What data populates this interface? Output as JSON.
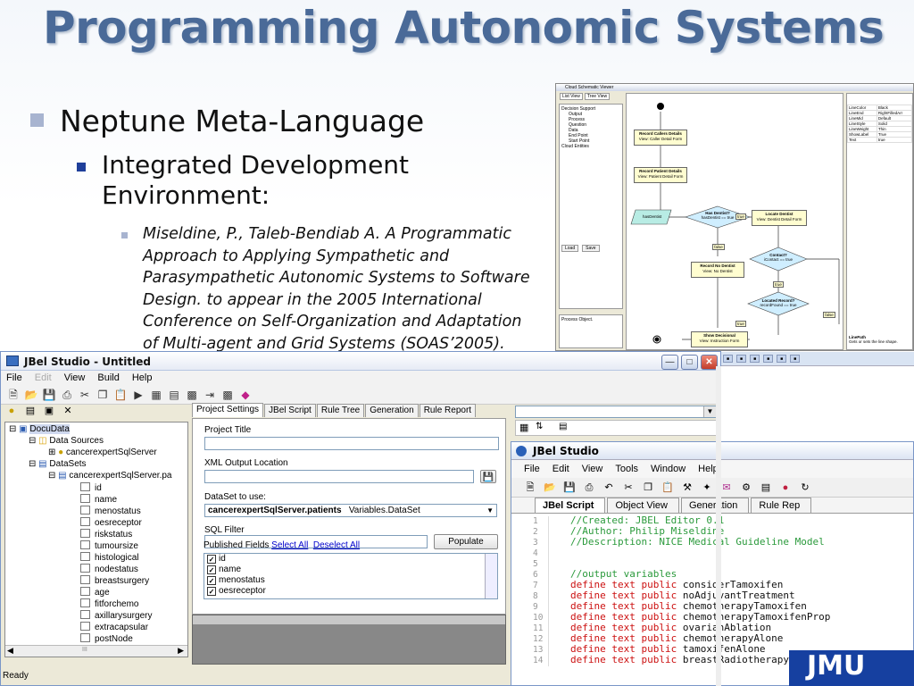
{
  "slide": {
    "title": "Programming Autonomic Systems",
    "bullet1": "Neptune Meta-Language",
    "bullet2": "Integrated Development Environment:",
    "bullet3": "Miseldine, P., Taleb-Bendiab A. A Programmatic Approach to Applying Sympathetic and Parasympathetic Autonomic Systems to Software Design. to appear in the 2005 International Conference on Self-Organization and Adaptation of Multi-agent and Grid Systems (SOAS’2005)."
  },
  "schematic_viewer": {
    "title": "Cloud Schematic Viewer",
    "tabs": [
      "List View",
      "Tree View"
    ],
    "tree": [
      "Decision Support",
      "Output",
      "Process",
      "Question",
      "Data",
      "End Point",
      "Start Point",
      "Cloud Entities"
    ],
    "buttons": [
      "Load",
      "Save"
    ],
    "process_label": "Process Object.",
    "nodes": {
      "n1_title": "Record Callers Details",
      "n1_view": "View: Caller Detail Form",
      "n2_title": "Record Patient Details",
      "n2_view": "View: Patient Detail Form",
      "has_dentist": "hasDentist",
      "d1_title": "Has Dentist?",
      "d1_cond": "hasDentist == true",
      "locate_title": "Locate Dentist",
      "locate_view": "View: Dentist Detail Form",
      "contact_title": "Contact?",
      "contact_cond": "iContact == true",
      "record_no_title": "Record No Dentist",
      "record_no_view": "View: No Dentist",
      "located_title": "Located Record?",
      "located_cond": "recordFound == true",
      "show_title": "Show Decisional",
      "show_view": "View: Instruction Form",
      "true_label": "true",
      "false_label": "false"
    },
    "props": [
      [
        "LineColor",
        "Black"
      ],
      [
        "LineEnd",
        "RightFilledArr"
      ],
      [
        "LineMid",
        "Default"
      ],
      [
        "LineStyle",
        "Solid"
      ],
      [
        "LineWeight",
        "Thin"
      ],
      [
        "ShowLabel",
        "True"
      ],
      [
        "Text",
        "true"
      ]
    ],
    "props_footer_title": "LinePath",
    "props_footer_text": "Gets or sets the line shape."
  },
  "jbel_main": {
    "title": "JBel Studio - Untitled",
    "menu": [
      "File",
      "Edit",
      "View",
      "Build",
      "Help"
    ],
    "tree": {
      "root": "DocuData",
      "data_sources": "Data Sources",
      "source1": "cancerexpertSqlServer",
      "datasets": "DataSets",
      "dataset1": "cancerexpertSqlServer.pa",
      "fields": [
        "id",
        "name",
        "menostatus",
        "oesreceptor",
        "riskstatus",
        "tumoursize",
        "histological",
        "nodestatus",
        "breastsurgery",
        "age",
        "fitforchemo",
        "axillarysurgery",
        "extracapsular",
        "postNode"
      ]
    },
    "tabs": [
      "Project Settings",
      "JBel Script",
      "Rule Tree",
      "Generation",
      "Rule Report"
    ],
    "project_title_label": "Project Title",
    "xml_output_label": "XML Output Location",
    "dataset_label": "DataSet to use:",
    "dataset_value": "cancerexpertSqlServer.patients",
    "dataset_type": "Variables.DataSet",
    "sql_filter_label": "SQL Filter",
    "populate_label": "Populate",
    "published_fields_label": "Published Fields",
    "select_all": "Select All",
    "deselect_all": "Deselect All",
    "checked_fields": [
      "id",
      "name",
      "menostatus",
      "oesreceptor"
    ],
    "status": "Ready",
    "scroll_label": "III"
  },
  "jbel_code": {
    "title": "JBel Studio",
    "menu": [
      "File",
      "Edit",
      "View",
      "Tools",
      "Window",
      "Help"
    ],
    "tabs": [
      "JBel Script",
      "Object View",
      "Generation",
      "Rule Rep"
    ],
    "lines": [
      {
        "n": "1",
        "type": "comment",
        "text": "//Created: JBEL Editor 0.1"
      },
      {
        "n": "2",
        "type": "comment",
        "text": "//Author: Philip Miseldine"
      },
      {
        "n": "3",
        "type": "comment",
        "text": "//Description: NICE Medical Guideline Model"
      },
      {
        "n": "4",
        "type": "blank",
        "text": ""
      },
      {
        "n": "5",
        "type": "blank",
        "text": ""
      },
      {
        "n": "6",
        "type": "comment",
        "text": "//output variables"
      },
      {
        "n": "7",
        "type": "define",
        "text": "considerTamoxifen"
      },
      {
        "n": "8",
        "type": "define",
        "text": "noAdjuvantTreatment"
      },
      {
        "n": "9",
        "type": "define",
        "text": "chemotherapyTamoxifen"
      },
      {
        "n": "10",
        "type": "define",
        "text": "chemotherapyTamoxifenProp"
      },
      {
        "n": "11",
        "type": "define",
        "text": "ovarianAblation"
      },
      {
        "n": "12",
        "type": "define",
        "text": "chemotherapyAlone"
      },
      {
        "n": "13",
        "type": "define",
        "text": "tamoxifenAlone"
      },
      {
        "n": "14",
        "type": "define",
        "text": "breastRadiotherapy"
      }
    ],
    "define_prefix": "define text public "
  },
  "logo_text": "JMU"
}
